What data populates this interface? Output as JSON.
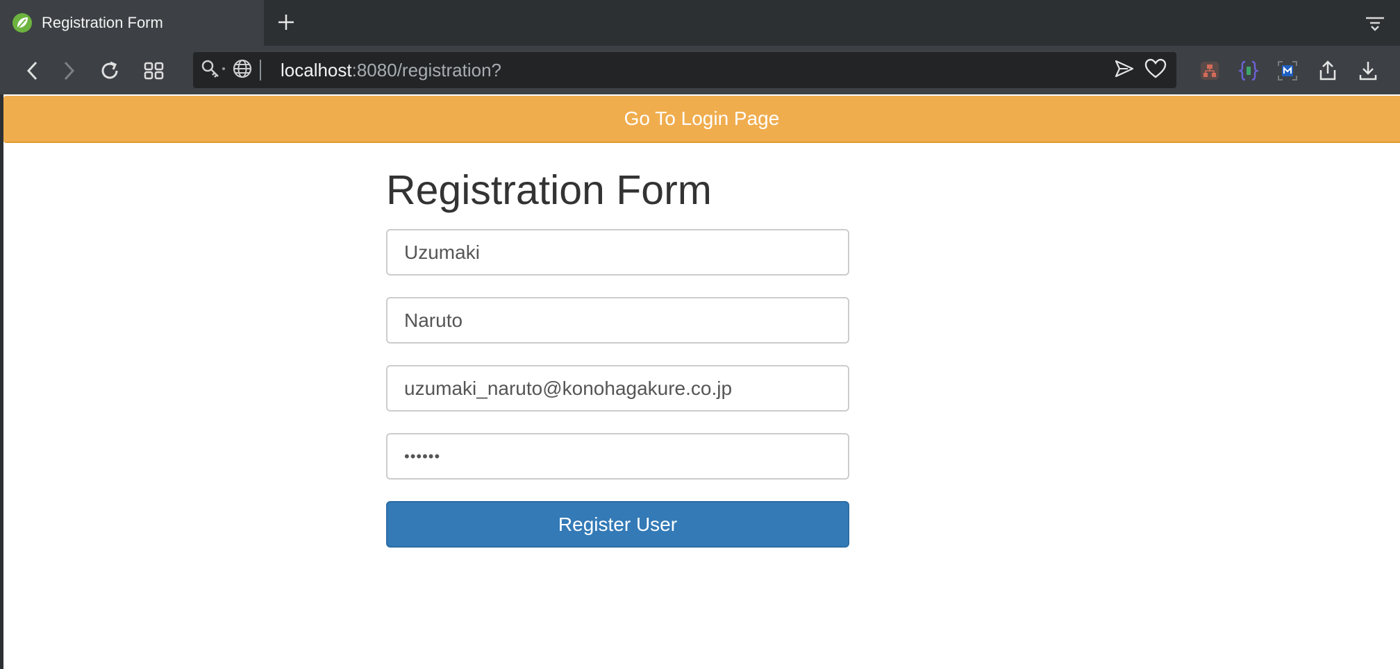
{
  "browser": {
    "tab_title": "Registration Form",
    "url_host": "localhost",
    "url_rest": ":8080/registration?"
  },
  "page": {
    "login_link_label": "Go To Login Page",
    "form_title": "Registration Form",
    "fields": {
      "last_name": "Uzumaki",
      "first_name": "Naruto",
      "email": "uzumaki_naruto@konohagakure.co.jp",
      "password": "••••••"
    },
    "register_label": "Register User"
  },
  "colors": {
    "banner": "#f0ad4e",
    "primary_button": "#337ab7",
    "chrome_dark": "#2d3033",
    "chrome_toolbar": "#3d4145"
  },
  "icons": {
    "favicon": "spring-leaf-icon",
    "back": "chevron-left-icon",
    "forward": "chevron-right-icon",
    "reload": "reload-icon",
    "speed_dial": "grid-icon",
    "site_info": "key-icon",
    "globe": "globe-icon",
    "send": "send-icon",
    "bookmark": "heart-icon",
    "share": "share-icon",
    "download": "download-icon"
  }
}
